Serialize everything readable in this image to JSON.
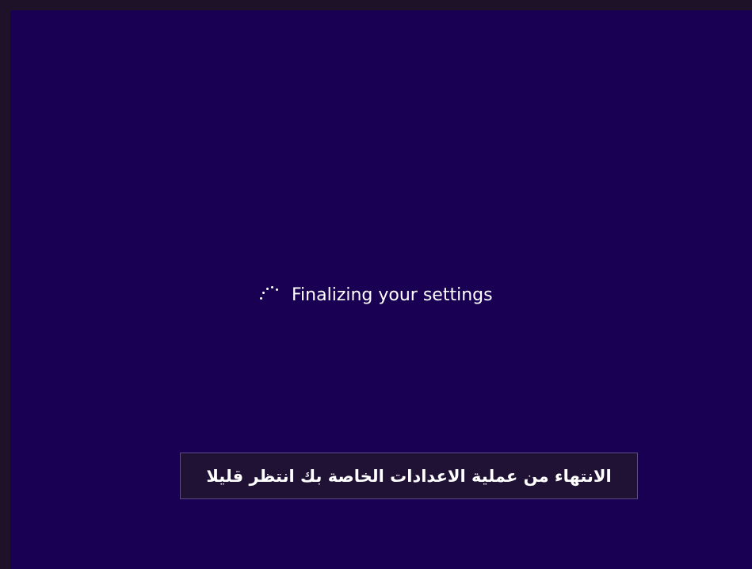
{
  "setup": {
    "status_text": "Finalizing your settings",
    "spinner_icon": "loading-spinner-icon",
    "background_color": "#190052"
  },
  "caption": {
    "text": "الانتهاء من عملية الاعدادات الخاصة بك انتظر قليلا"
  }
}
